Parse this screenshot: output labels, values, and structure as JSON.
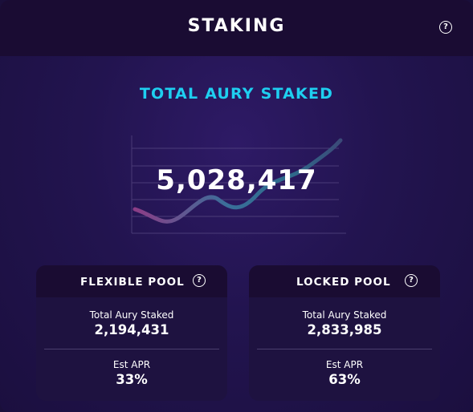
{
  "header": {
    "title": "STAKING"
  },
  "total": {
    "label": "TOTAL AURY STAKED",
    "value": "5,028,417"
  },
  "pools": [
    {
      "title": "FLEXIBLE POOL",
      "staked_label": "Total Aury Staked",
      "staked_value": "2,194,431",
      "apr_label": "Est APR",
      "apr_value": "33%"
    },
    {
      "title": "LOCKED POOL",
      "staked_label": "Total Aury Staked",
      "staked_value": "2,833,985",
      "apr_label": "Est APR",
      "apr_value": "63%"
    }
  ],
  "icons": {
    "help": "help-circle-icon",
    "help_glyph": "?"
  },
  "colors": {
    "accent": "#1ecff0",
    "background": "#22144f",
    "header": "#1a0c33",
    "card": "#1e1240"
  }
}
